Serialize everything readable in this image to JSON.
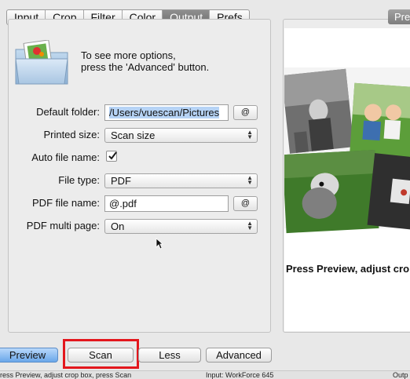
{
  "tabs": [
    {
      "label": "Input",
      "active": false
    },
    {
      "label": "Crop",
      "active": false
    },
    {
      "label": "Filter",
      "active": false
    },
    {
      "label": "Color",
      "active": false
    },
    {
      "label": "Output",
      "active": true
    },
    {
      "label": "Prefs",
      "active": false
    }
  ],
  "info": {
    "line1": "To see more options,",
    "line2": "press the 'Advanced' button."
  },
  "form": {
    "default_folder_label": "Default folder:",
    "default_folder_value": "/Users/vuescan/Pictures",
    "default_folder_browse": "@",
    "printed_size_label": "Printed size:",
    "printed_size_value": "Scan size",
    "auto_file_name_label": "Auto file name:",
    "auto_file_name_checked": true,
    "file_type_label": "File type:",
    "file_type_value": "PDF",
    "pdf_file_name_label": "PDF file name:",
    "pdf_file_name_value": "@.pdf",
    "pdf_file_name_browse": "@",
    "pdf_multi_page_label": "PDF multi page:",
    "pdf_multi_page_value": "On"
  },
  "preview": {
    "tab_label": "Pre",
    "caption": "Press Preview, adjust cro"
  },
  "buttons": {
    "preview": "Preview",
    "scan": "Scan",
    "less": "Less",
    "advanced": "Advanced"
  },
  "status": {
    "left": "ress Preview, adjust crop box, press Scan",
    "middle": "Input: WorkForce 645",
    "right": "Outp"
  },
  "colors": {
    "highlight": "#e3171d",
    "default_button": "#6aa7ea"
  }
}
